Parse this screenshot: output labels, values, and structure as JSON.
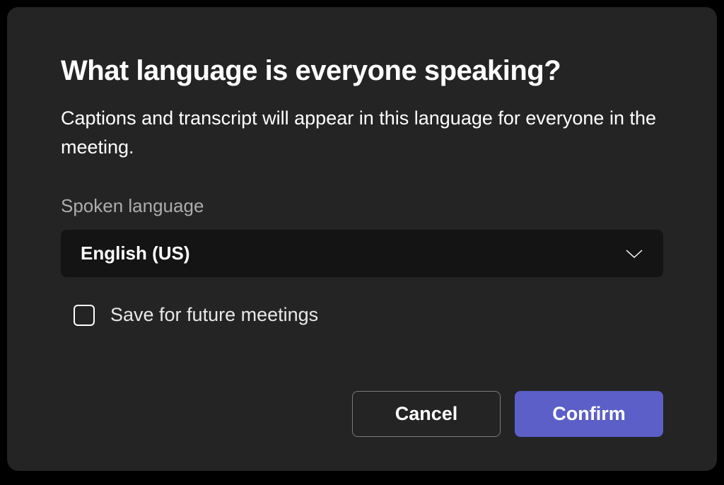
{
  "dialog": {
    "title": "What language is everyone speaking?",
    "description": "Captions and transcript will appear in this language for everyone in the meeting.",
    "field_label": "Spoken language",
    "dropdown": {
      "selected": "English (US)"
    },
    "checkbox": {
      "label": "Save for future meetings",
      "checked": false
    },
    "buttons": {
      "cancel": "Cancel",
      "confirm": "Confirm"
    }
  }
}
